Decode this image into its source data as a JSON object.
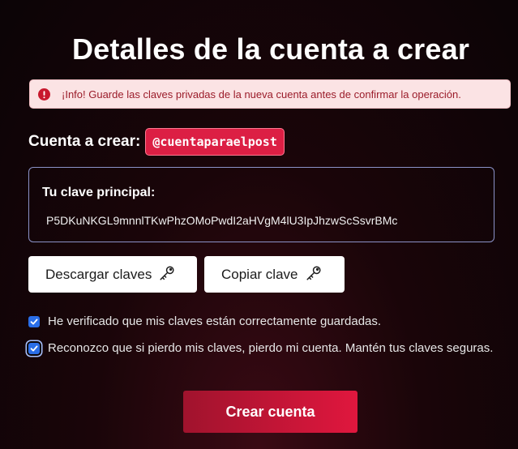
{
  "page": {
    "title": "Detalles de la cuenta a crear"
  },
  "alert": {
    "icon": "exclamation-circle-icon",
    "text": "¡Info! Guarde las claves privadas de la nueva cuenta antes de confirmar la operación."
  },
  "account": {
    "label": "Cuenta a crear:",
    "name": "@cuentaparaelpost"
  },
  "key": {
    "label": "Tu clave principal:",
    "value": "P5DKuNKGL9mnnlTKwPhzOMoPwdI2aHVgM4lU3IpJhzwScSsvrBMc"
  },
  "buttons": {
    "download": "Descargar claves",
    "copy": "Copiar clave",
    "icon": "key-icon"
  },
  "checks": [
    {
      "label": "He verificado que mis claves están correctamente guardadas.",
      "checked": true
    },
    {
      "label": "Reconozco que si pierdo mis claves, pierdo mi cuenta. Mantén tus claves seguras.",
      "checked": true
    }
  ],
  "submit": {
    "label": "Crear cuenta"
  },
  "colors": {
    "accent": "#dc1f44",
    "checkbox": "#2a6ee8",
    "alert_bg": "#fbe3e4",
    "alert_text": "#9b1c2a"
  }
}
